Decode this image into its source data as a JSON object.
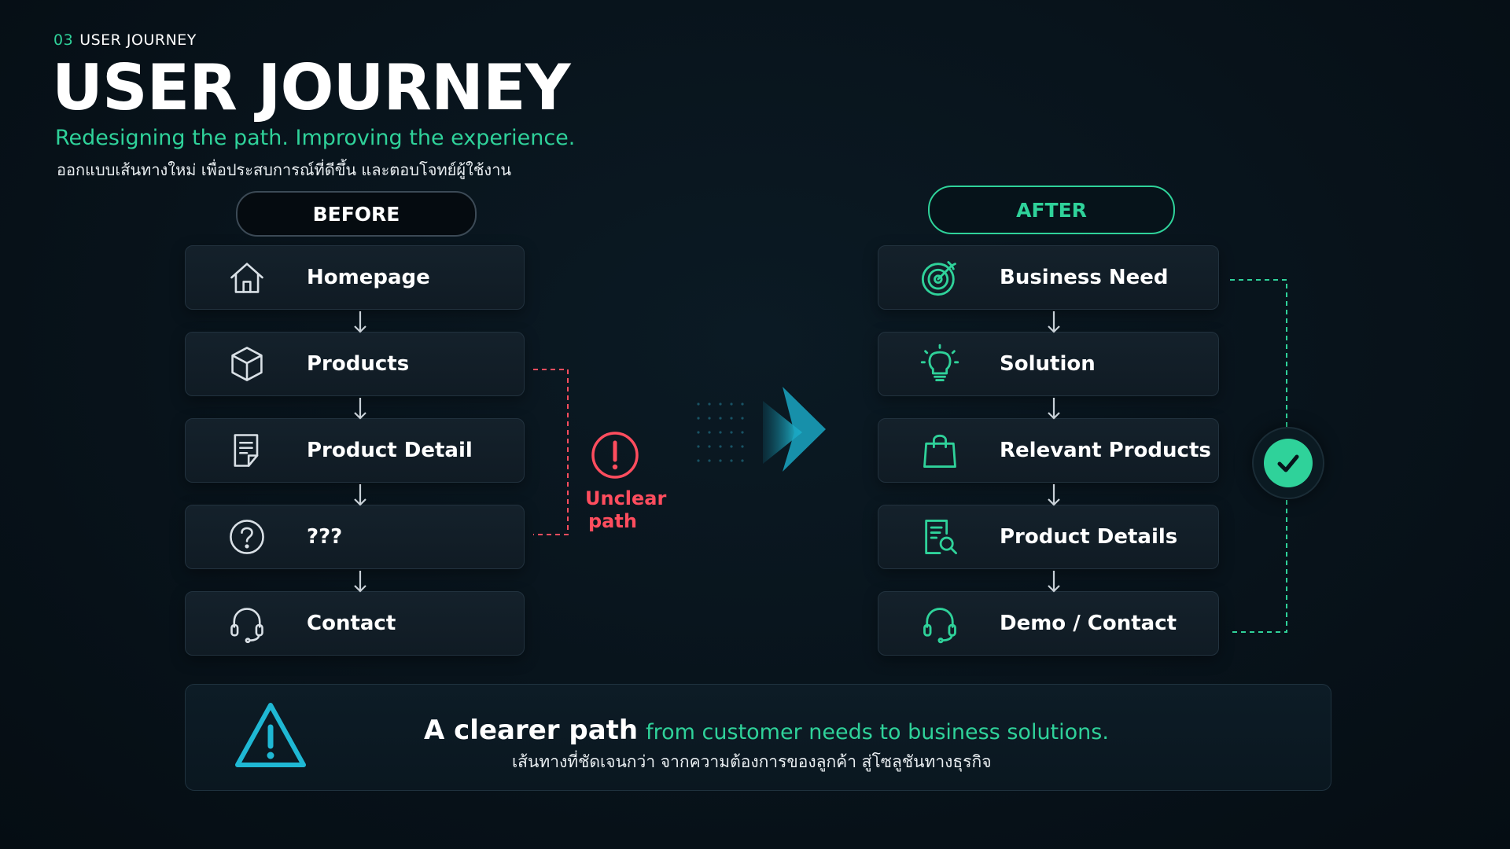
{
  "header": {
    "section_number": "03",
    "section_name": "USER JOURNEY",
    "title": "USER JOURNEY",
    "subtitle": "Redesigning the path. Improving the experience.",
    "subtitle_th": "ออกแบบเส้นทางใหม่ เพื่อประสบการณ์ที่ดีขึ้น และตอบโจทย์ผู้ใช้งาน"
  },
  "before": {
    "label": "BEFORE",
    "steps": [
      {
        "label": "Homepage",
        "icon": "home-icon"
      },
      {
        "label": "Products",
        "icon": "box-icon"
      },
      {
        "label": "Product Detail",
        "icon": "document-icon"
      },
      {
        "label": "???",
        "icon": "question-icon"
      },
      {
        "label": "Contact",
        "icon": "headset-icon"
      }
    ],
    "warning": {
      "line1": "Unclear",
      "line2": "path",
      "icon": "alert-circle-icon"
    }
  },
  "after": {
    "label": "AFTER",
    "steps": [
      {
        "label": "Business Need",
        "icon": "target-icon"
      },
      {
        "label": "Solution",
        "icon": "lightbulb-icon"
      },
      {
        "label": "Relevant Products",
        "icon": "shopping-bag-icon"
      },
      {
        "label": "Product Details",
        "icon": "document-search-icon"
      },
      {
        "label": "Demo / Contact",
        "icon": "headset-icon"
      }
    ],
    "status_icon": "check-circle-icon"
  },
  "banner": {
    "headline": "A clearer path",
    "headline_rest": "from customer needs to business solutions.",
    "subtext": "เส้นทางที่ชัดเจนกว่า จากความต้องการของลูกค้า สู่โซลูชันทางธุรกิจ",
    "icon": "warning-triangle-icon"
  },
  "colors": {
    "accent_green": "#2fd29a",
    "alert_red": "#ff4d5e",
    "accent_cyan": "#1fb8d4",
    "background": "#08131b"
  }
}
